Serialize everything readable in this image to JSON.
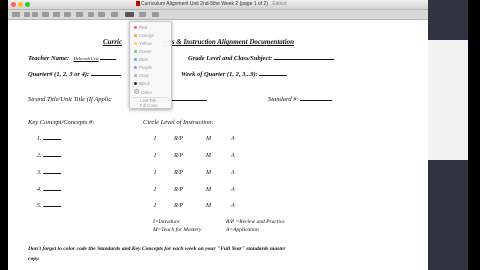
{
  "window": {
    "title": "Curriculum Alignment Unit 2nd-5the Week 2 (page 1 of 2)",
    "mode": "Edited"
  },
  "colors": {
    "red": "#ff6159",
    "yellow": "#ffbd2e",
    "green": "#28c941"
  },
  "menu": {
    "items": [
      {
        "label": "Red",
        "color": "#ff5d5d"
      },
      {
        "label": "Orange",
        "color": "#ffa447"
      },
      {
        "label": "Yellow",
        "color": "#ffd84d"
      },
      {
        "label": "Green",
        "color": "#6ad16a"
      },
      {
        "label": "Blue",
        "color": "#5ea6ff"
      },
      {
        "label": "Purple",
        "color": "#c07bff"
      },
      {
        "label": "Gray",
        "color": "#b0b0b0"
      },
      {
        "label": "Black",
        "color": "#333333"
      },
      {
        "label": "Other",
        "color": "#dddddd"
      }
    ],
    "extra": [
      "Line Fill",
      "Fill Color"
    ]
  },
  "document": {
    "heading_left": "Curric",
    "heading_right": "ards & Instruction Alignment Documentation",
    "teacher_label": "Teacher Name:",
    "teacher_value": "Deborah Cris",
    "grade_label": "Grade Level and Class/Subject:",
    "quarter_label": "Quarter# (1, 2, 3 or 4): ",
    "week_label": "Week of Quarter (1, 2, 3...9): ",
    "strand_label": "Strand Title/Unit Title (If Applic",
    "standard_label": "Standard #:",
    "key_label": "Key Concept/Concepts #:",
    "circle_label": "Circle Level of Instruction:",
    "rows": [
      {
        "num": "1.",
        "levels": [
          "I",
          "R/P",
          "M",
          "A"
        ]
      },
      {
        "num": "2.",
        "levels": [
          "I",
          "R/P",
          "M",
          "A"
        ]
      },
      {
        "num": "3.",
        "levels": [
          "I",
          "R/P",
          "M",
          "A"
        ]
      },
      {
        "num": "4.",
        "levels": [
          "I",
          "R/P",
          "M",
          "A"
        ]
      },
      {
        "num": "5.",
        "levels": [
          "I",
          "R/P",
          "M",
          "A"
        ]
      }
    ],
    "legend_i": "I=Introduce",
    "legend_rp": "R/P =Review and Practice",
    "legend_m": "M=Teach for Mastery",
    "legend_a": "A=Application",
    "footer": "Don't forget to color code the Standards and Key Concepts for each week on your \"Full Year\" standards master",
    "footer2": "copy."
  }
}
